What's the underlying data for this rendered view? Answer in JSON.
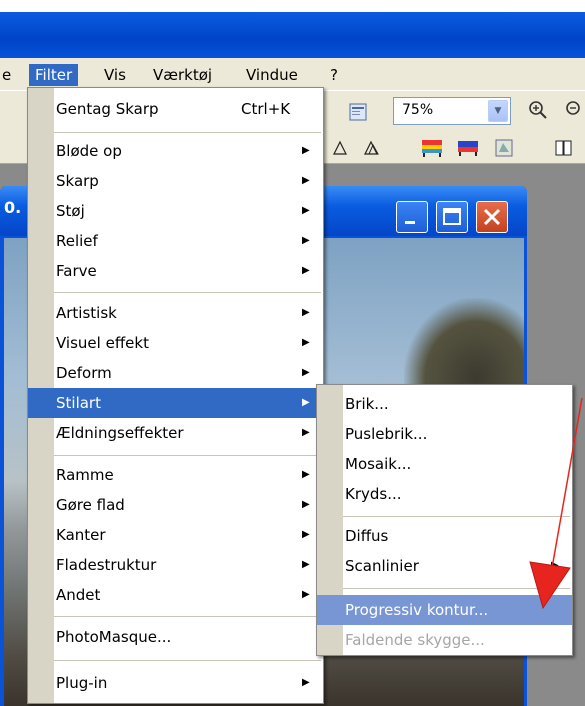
{
  "menubar": {
    "items": [
      "e",
      "Filter",
      "Vis",
      "Værktøj",
      "Vindue",
      "?"
    ]
  },
  "toolbar": {
    "zoom_value": "75%"
  },
  "filter_menu": {
    "items": [
      {
        "label": "Gentag Skarp",
        "shortcut": "Ctrl+K"
      },
      {
        "label": "Bløde op"
      },
      {
        "label": "Skarp"
      },
      {
        "label": "Støj"
      },
      {
        "label": "Relief"
      },
      {
        "label": "Farve"
      },
      {
        "label": "Artistisk"
      },
      {
        "label": "Visuel effekt"
      },
      {
        "label": "Deform"
      },
      {
        "label": "Stilart"
      },
      {
        "label": "Ældningseffekter"
      },
      {
        "label": "Ramme"
      },
      {
        "label": "Gøre flad"
      },
      {
        "label": "Kanter"
      },
      {
        "label": "Fladestruktur"
      },
      {
        "label": "Andet"
      },
      {
        "label": "PhotoMasque..."
      },
      {
        "label": "Plug-in"
      }
    ]
  },
  "stilart_menu": {
    "items": [
      {
        "label": "Brik..."
      },
      {
        "label": "Puslebrik..."
      },
      {
        "label": "Mosaik..."
      },
      {
        "label": "Kryds..."
      },
      {
        "label": "Diffus"
      },
      {
        "label": "Scanlinier"
      },
      {
        "label": "Progressiv kontur..."
      },
      {
        "label": "Faldende skygge..."
      }
    ]
  },
  "document": {
    "title_fragment": "0."
  },
  "colors": {
    "highlight": "#316ac5",
    "annotation_arrow": "#e8241e"
  }
}
